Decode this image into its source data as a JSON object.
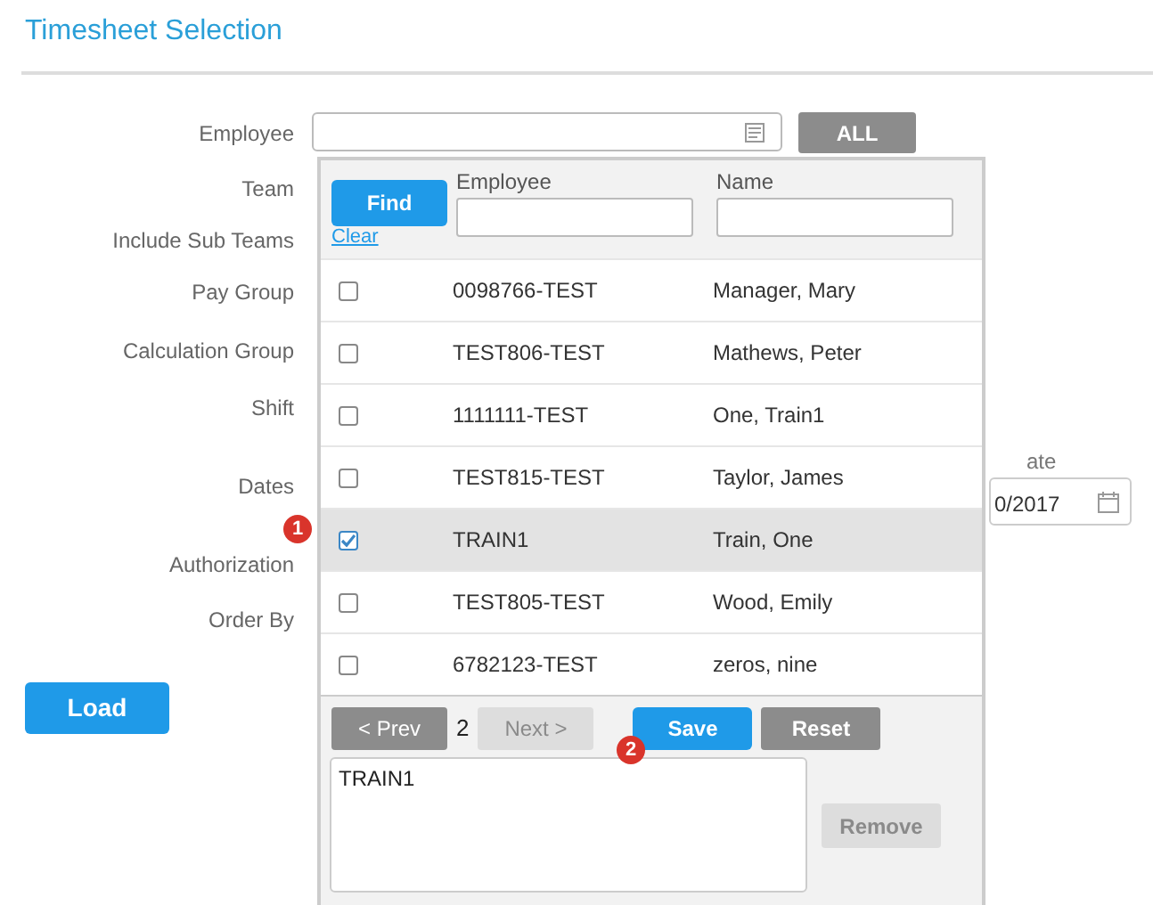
{
  "title": "Timesheet Selection",
  "form": {
    "labels": [
      "Employee",
      "Team",
      "Include Sub Teams",
      "Pay Group",
      "Calculation Group",
      "Shift",
      "Dates",
      "Authorization",
      "Order By"
    ],
    "all_button": "ALL",
    "load_button": "Load",
    "date_label": "ate",
    "date_value": "0/2017"
  },
  "picker": {
    "find_button": "Find",
    "clear_link": "Clear",
    "columns": [
      "Employee",
      "Name"
    ],
    "rows": [
      {
        "employee": "0098766-TEST",
        "name": "Manager, Mary",
        "checked": false
      },
      {
        "employee": "TEST806-TEST",
        "name": "Mathews, Peter",
        "checked": false
      },
      {
        "employee": "1111111-TEST",
        "name": "One, Train1",
        "checked": false
      },
      {
        "employee": "TEST815-TEST",
        "name": "Taylor, James",
        "checked": false
      },
      {
        "employee": "TRAIN1",
        "name": "Train, One",
        "checked": true
      },
      {
        "employee": "TEST805-TEST",
        "name": "Wood, Emily",
        "checked": false
      },
      {
        "employee": "6782123-TEST",
        "name": "zeros, nine",
        "checked": false
      }
    ],
    "prev_button": {
      "label": "< Prev",
      "disabled": false
    },
    "page": "2",
    "next_button": {
      "label": "Next >",
      "disabled": true
    },
    "save_button": "Save",
    "reset_button": "Reset",
    "selected_list": [
      "TRAIN1"
    ],
    "remove_button": {
      "label": "Remove",
      "disabled": true
    }
  },
  "callouts": [
    "1",
    "2"
  ]
}
